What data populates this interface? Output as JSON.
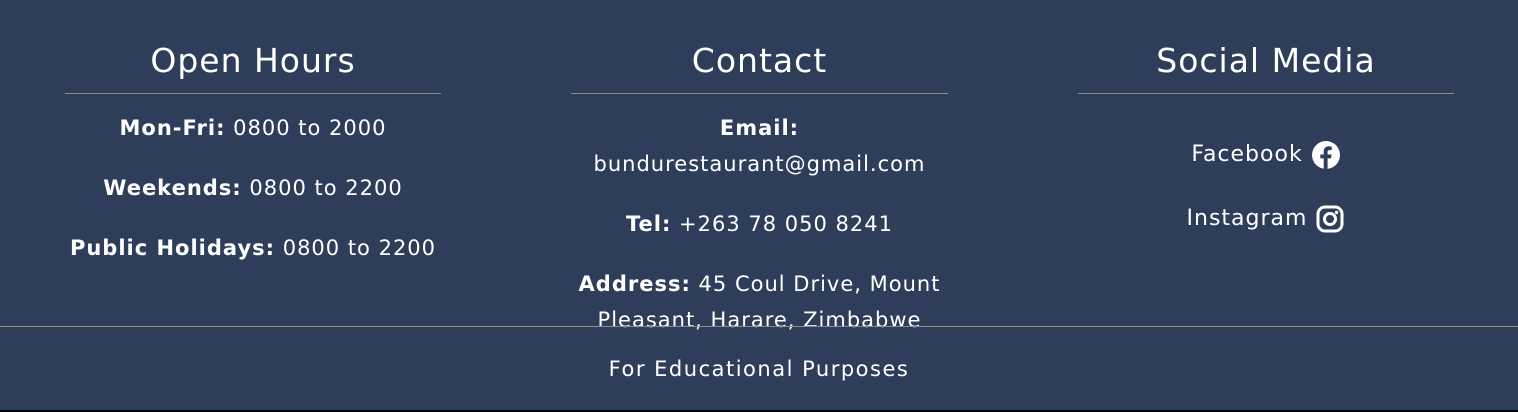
{
  "open_hours": {
    "title": "Open Hours",
    "rows": [
      {
        "label": "Mon-Fri:",
        "value": " 0800 to 2000"
      },
      {
        "label": "Weekends:",
        "value": " 0800 to 2200"
      },
      {
        "label": "Public Holidays:",
        "value": " 0800 to 2200"
      }
    ]
  },
  "contact": {
    "title": "Contact",
    "email_label": "Email:",
    "email_value": " bundurestaurant@gmail.com",
    "tel_label": "Tel:",
    "tel_value": " +263 78 050 8241",
    "address_label": "Address:",
    "address_value": " 45 Coul Drive, Mount Pleasant, Harare, Zimbabwe"
  },
  "social": {
    "title": "Social Media",
    "links": [
      {
        "label": "Facebook",
        "icon": "facebook-icon"
      },
      {
        "label": "Instagram",
        "icon": "instagram-icon"
      }
    ]
  },
  "footer_note": "For Educational Purposes",
  "colors": {
    "background": "#2e3e5a",
    "divider": "#8b8f87",
    "text": "#ffffff"
  }
}
